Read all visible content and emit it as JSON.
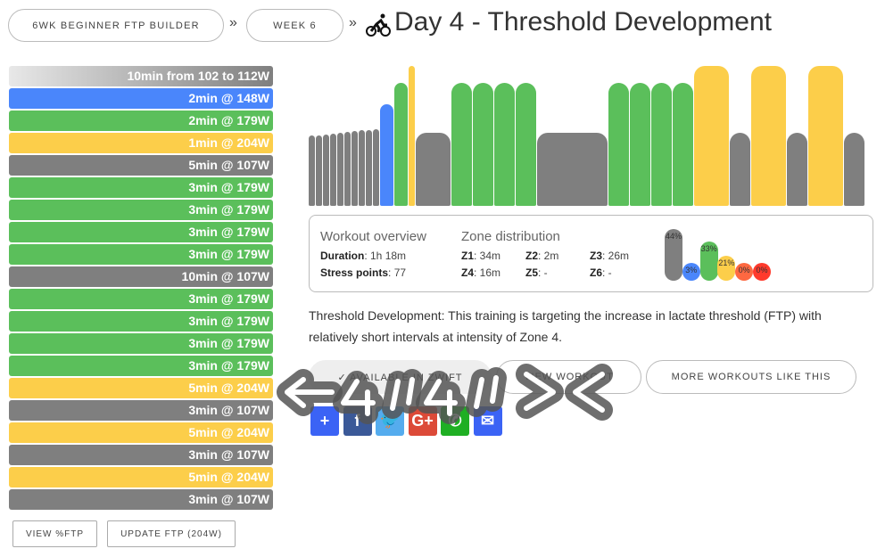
{
  "breadcrumb": {
    "plan": "6WK BEGINNER FTP BUILDER",
    "week": "WEEK 6",
    "sep": "»"
  },
  "title": "Day 4 - Threshold Development",
  "colors": {
    "z1": "#7f7f7f",
    "z2": "#4a86fb",
    "z3": "#5bbf5b",
    "z4": "#fcce4a",
    "z5": "#fe6841",
    "z6": "#ff3a2c"
  },
  "segments": [
    {
      "label": "10min from 102 to 112W",
      "min": 10,
      "from": 102,
      "to": 112,
      "zone": "ramp"
    },
    {
      "label": "2min @ 148W",
      "min": 2,
      "w": 148,
      "zone": "z2"
    },
    {
      "label": "2min @ 179W",
      "min": 2,
      "w": 179,
      "zone": "z3"
    },
    {
      "label": "1min @ 204W",
      "min": 1,
      "w": 204,
      "zone": "z4"
    },
    {
      "label": "5min @ 107W",
      "min": 5,
      "w": 107,
      "zone": "z1"
    },
    {
      "label": "3min @ 179W",
      "min": 3,
      "w": 179,
      "zone": "z3"
    },
    {
      "label": "3min @ 179W",
      "min": 3,
      "w": 179,
      "zone": "z3"
    },
    {
      "label": "3min @ 179W",
      "min": 3,
      "w": 179,
      "zone": "z3"
    },
    {
      "label": "3min @ 179W",
      "min": 3,
      "w": 179,
      "zone": "z3"
    },
    {
      "label": "10min @ 107W",
      "min": 10,
      "w": 107,
      "zone": "z1"
    },
    {
      "label": "3min @ 179W",
      "min": 3,
      "w": 179,
      "zone": "z3"
    },
    {
      "label": "3min @ 179W",
      "min": 3,
      "w": 179,
      "zone": "z3"
    },
    {
      "label": "3min @ 179W",
      "min": 3,
      "w": 179,
      "zone": "z3"
    },
    {
      "label": "3min @ 179W",
      "min": 3,
      "w": 179,
      "zone": "z3"
    },
    {
      "label": "5min @ 204W",
      "min": 5,
      "w": 204,
      "zone": "z4"
    },
    {
      "label": "3min @ 107W",
      "min": 3,
      "w": 107,
      "zone": "z1"
    },
    {
      "label": "5min @ 204W",
      "min": 5,
      "w": 204,
      "zone": "z4"
    },
    {
      "label": "3min @ 107W",
      "min": 3,
      "w": 107,
      "zone": "z1"
    },
    {
      "label": "5min @ 204W",
      "min": 5,
      "w": 204,
      "zone": "z4"
    },
    {
      "label": "3min @ 107W",
      "min": 3,
      "w": 107,
      "zone": "z1"
    }
  ],
  "overview": {
    "heading": "Workout overview",
    "duration_label": "Duration",
    "duration": ": 1h 18m",
    "stress_label": "Stress points",
    "stress": ": 77"
  },
  "zones": {
    "heading": "Zone distribution",
    "items": [
      {
        "name": "Z1",
        "value": ": 34m",
        "pct": 44,
        "label": "44%"
      },
      {
        "name": "Z2",
        "value": ": 2m",
        "pct": 3,
        "label": "3%"
      },
      {
        "name": "Z3",
        "value": ": 26m",
        "pct": 33,
        "label": "33%"
      },
      {
        "name": "Z4",
        "value": ": 16m",
        "pct": 21,
        "label": "21%"
      },
      {
        "name": "Z5",
        "value": ": -",
        "pct": 0,
        "label": "0%"
      },
      {
        "name": "Z6",
        "value": ": -",
        "pct": 0,
        "label": "0%"
      }
    ]
  },
  "description": "Threshold Development: This training is targeting the increase in lactate threshold (FTP) with relatively short intervals at intensity of Zone 4.",
  "buttons": {
    "zwift": "✓ AVAILABLE IN ZWIFT",
    "view": "VIEW WORKOUT",
    "more": "MORE WORKOUTS LIKE THIS",
    "view_ftp": "VIEW %FTP",
    "update_ftp": "UPDATE FTP (204W)"
  },
  "social": [
    {
      "name": "share",
      "glyph": "+",
      "color": "#3b63f5"
    },
    {
      "name": "facebook",
      "glyph": "f",
      "color": "#3b5998"
    },
    {
      "name": "twitter",
      "glyph": "🐦",
      "color": "#55acee"
    },
    {
      "name": "google-plus",
      "glyph": "G+",
      "color": "#dc4a38"
    },
    {
      "name": "whatsapp",
      "glyph": "✆",
      "color": "#1faf23"
    },
    {
      "name": "email",
      "glyph": "✉",
      "color": "#3b63f5"
    }
  ]
}
